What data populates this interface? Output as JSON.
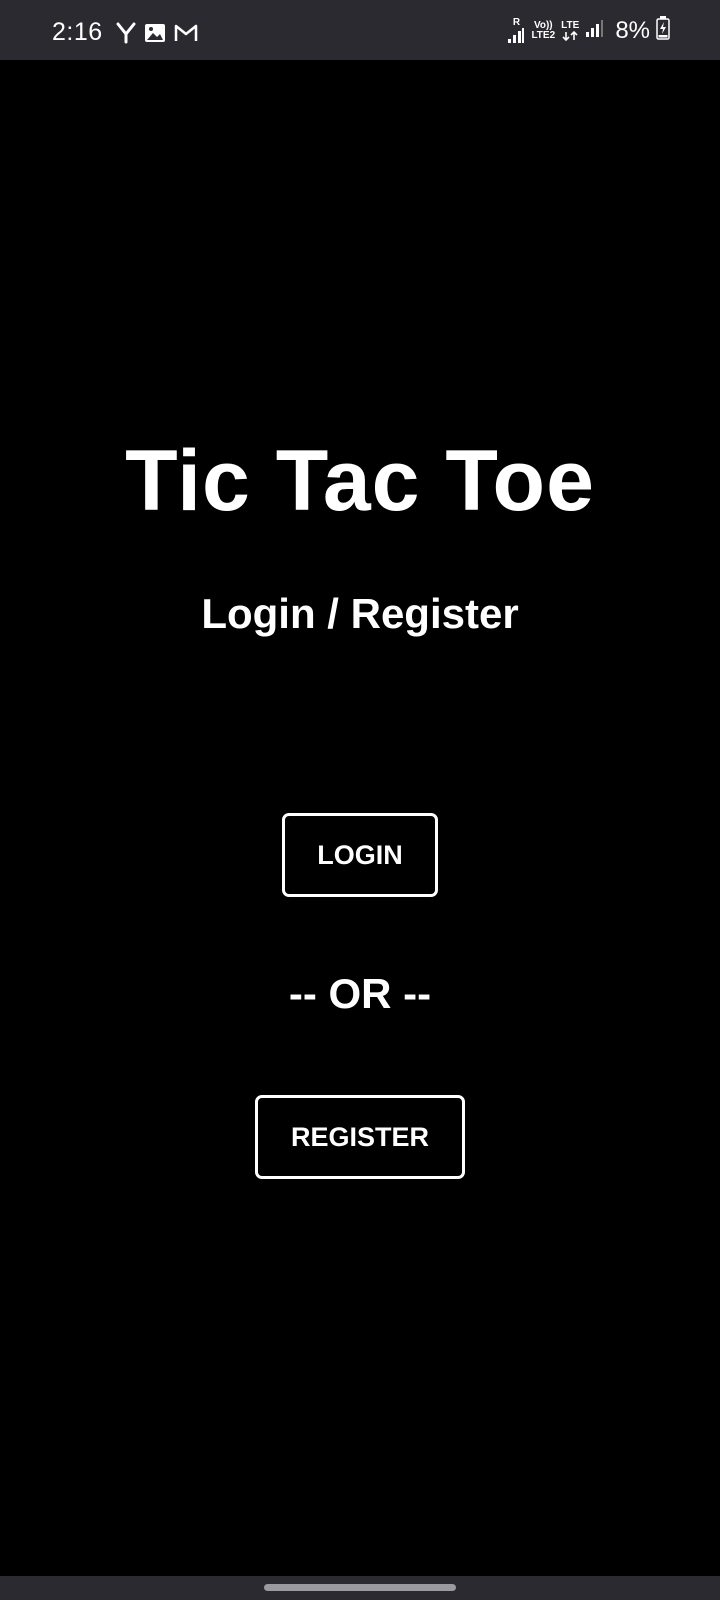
{
  "status_bar": {
    "time": "2:16",
    "left_icons": [
      "y-app-icon",
      "gallery-icon",
      "gmail-icon"
    ],
    "sim1_label": "R",
    "volte_label": "Vo))",
    "lte2_label": "LTE2",
    "lte_label": "LTE",
    "battery_percent": "8%"
  },
  "main": {
    "title": "Tic Tac Toe",
    "subtitle": "Login / Register",
    "login_button": "LOGIN",
    "or_separator": "-- OR --",
    "register_button": "REGISTER"
  },
  "colors": {
    "background": "#000000",
    "foreground": "#ffffff",
    "system_bar": "#2a2a30"
  }
}
